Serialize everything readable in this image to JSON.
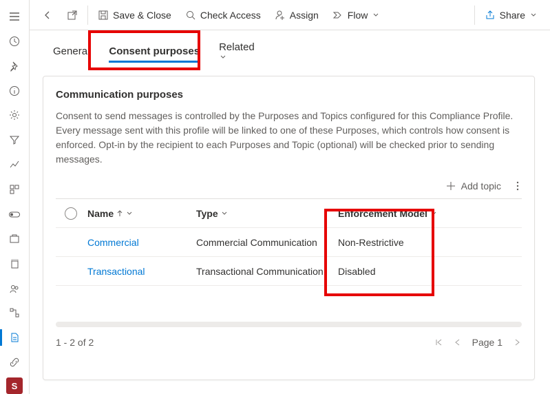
{
  "sidebar": {
    "badge": "S"
  },
  "toolbar": {
    "save_close": "Save & Close",
    "check_access": "Check Access",
    "assign": "Assign",
    "flow": "Flow",
    "share": "Share"
  },
  "tabs": {
    "general": "General",
    "consent": "Consent purposes",
    "related": "Related"
  },
  "card": {
    "title": "Communication purposes",
    "description": "Consent to send messages is controlled by the Purposes and Topics configured for this Compliance Profile. Every message sent with this profile will be linked to one of these Purposes, which controls how consent is enforced. Opt-in by the recipient to each Purposes and Topic (optional) will be checked prior to sending messages.",
    "add_topic": "Add topic"
  },
  "grid": {
    "headers": {
      "name": "Name",
      "type": "Type",
      "enforcement": "Enforcement Model"
    },
    "rows": [
      {
        "name": "Commercial",
        "type": "Commercial Communication",
        "enforcement": "Non-Restrictive"
      },
      {
        "name": "Transactional",
        "type": "Transactional Communication",
        "enforcement": "Disabled"
      }
    ]
  },
  "pager": {
    "status": "1 - 2 of 2",
    "page_label": "Page 1"
  }
}
